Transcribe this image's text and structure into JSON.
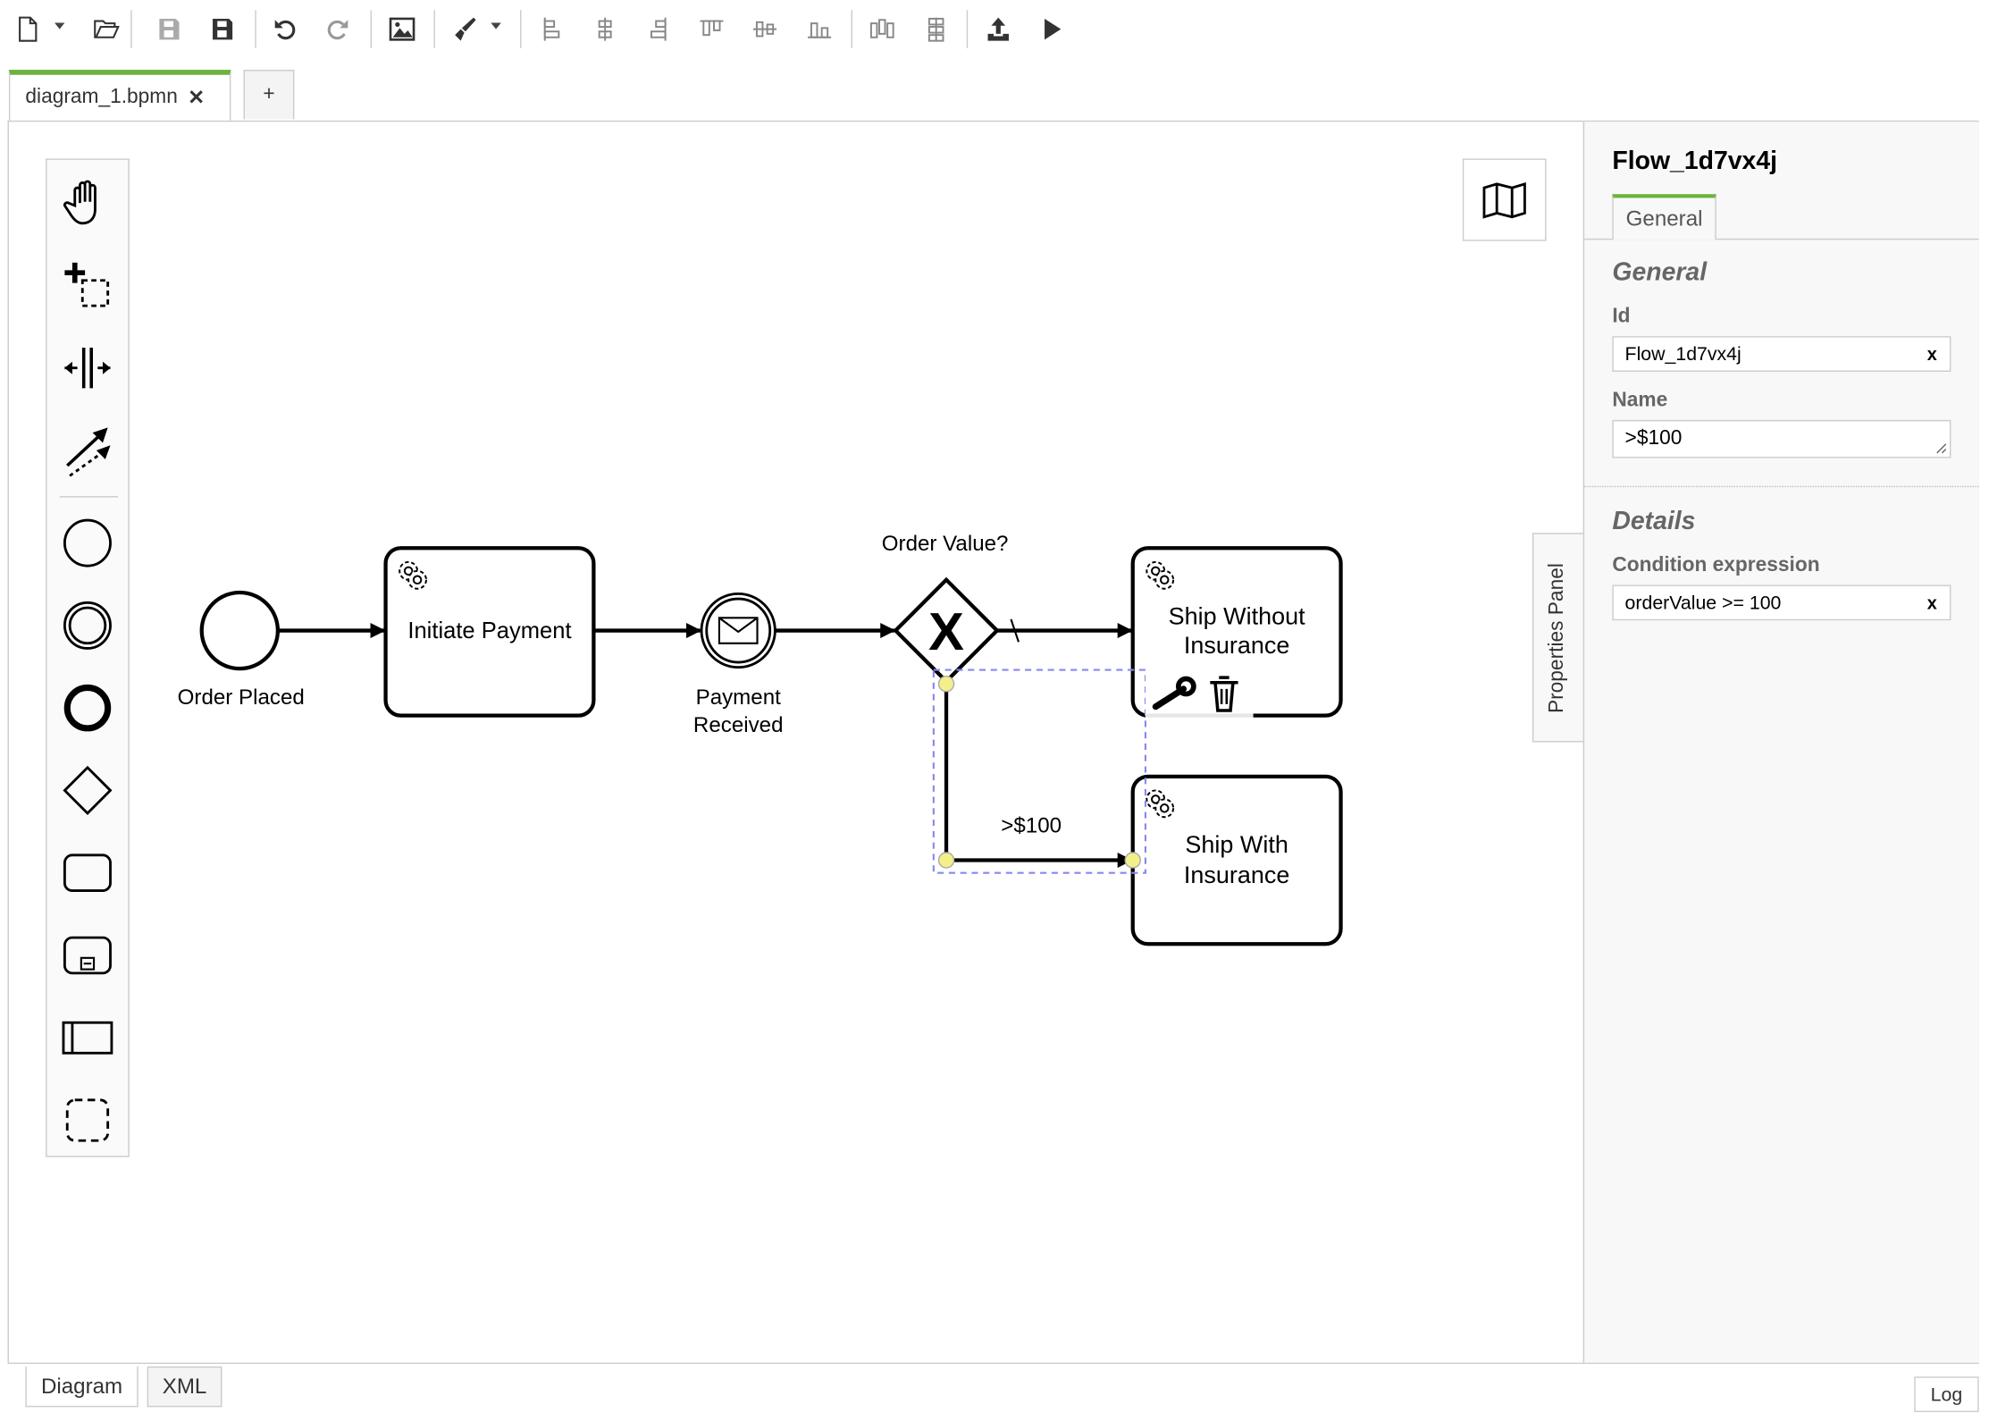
{
  "toolbar": {
    "icons": [
      "new-file-icon",
      "open-folder-icon",
      "save-icon",
      "save-as-icon",
      "undo-icon",
      "redo-icon",
      "export-image-icon",
      "color-brush-icon",
      "align-left-icon",
      "align-center-icon",
      "align-right-icon",
      "align-top-icon",
      "align-middle-icon",
      "align-bottom-icon",
      "distribute-horizontal-icon",
      "distribute-vertical-icon",
      "deploy-icon",
      "start-instance-icon"
    ]
  },
  "tabs": [
    {
      "label": "diagram_1.bpmn",
      "close": "✕",
      "active": true
    },
    {
      "label": "+"
    }
  ],
  "accent_color": "#6cb33e",
  "palette": [
    "hand-tool",
    "lasso-tool",
    "space-tool",
    "connect-tool",
    "start-event",
    "intermediate-event",
    "end-event",
    "gateway",
    "task",
    "subprocess",
    "pool",
    "group"
  ],
  "diagram": {
    "start_event": {
      "label": "Order Placed"
    },
    "task_initiate": {
      "label": "Initiate Payment"
    },
    "catch_event": {
      "label_line1": "Payment",
      "label_line2": "Received"
    },
    "gateway": {
      "label": "Order Value?",
      "marker": "X"
    },
    "task_without": {
      "line1": "Ship Without",
      "line2": "Insurance"
    },
    "task_with": {
      "line1": "Ship With",
      "line2": "Insurance"
    },
    "selected_flow": {
      "label": ">$100"
    }
  },
  "properties_panel": {
    "toggle_label": "Properties Panel",
    "title": "Flow_1d7vx4j",
    "tab": "General",
    "general_heading": "General",
    "id_label": "Id",
    "id_value": "Flow_1d7vx4j",
    "name_label": "Name",
    "name_value": ">$100",
    "details_heading": "Details",
    "condition_label": "Condition expression",
    "condition_value": "orderValue >= 100",
    "clear": "x"
  },
  "bottom_tabs": {
    "diagram": "Diagram",
    "xml": "XML",
    "log": "Log"
  }
}
